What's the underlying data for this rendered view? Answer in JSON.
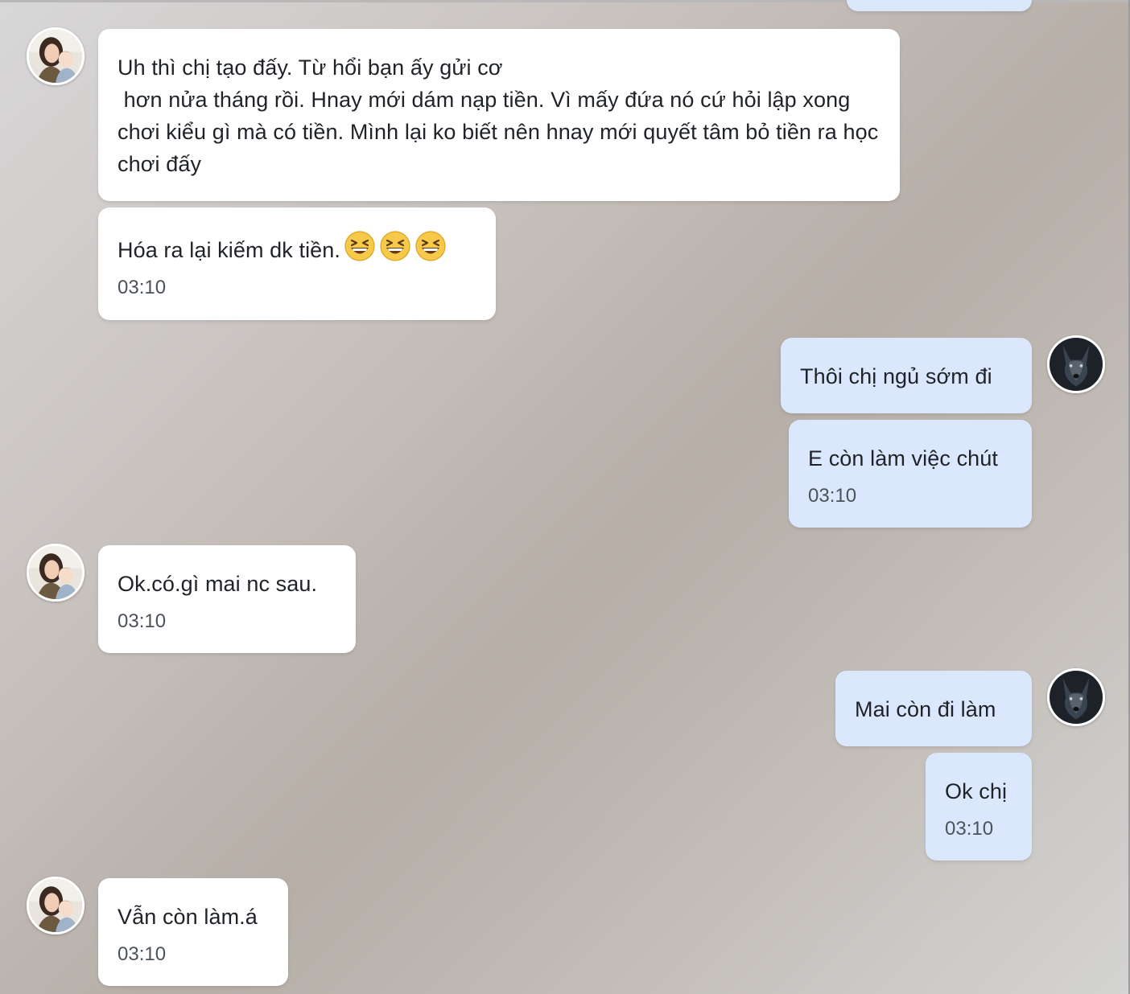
{
  "conversation": {
    "messages": [
      {
        "sender": "other",
        "text": "Uh thì chị tạo đấy. Từ hổi bạn ấy gửi cơ\n hơn nửa tháng rồi. Hnay mới dám nạp tiền. Vì mấy đứa nó cứ hỏi lập xong chơi kiểu gì mà có tiền. Mình lại ko biết nên hnay mới quyết tâm bỏ tiền ra học chơi đấy",
        "time": ""
      },
      {
        "sender": "other",
        "text": "Hóa ra lại kiếm dk tiền.",
        "emoji": [
          "grinning-squinting-face",
          "grinning-squinting-face",
          "grinning-squinting-face"
        ],
        "time": "03:10"
      },
      {
        "sender": "me",
        "text": "Thôi chị ngủ sớm đi",
        "time": ""
      },
      {
        "sender": "me",
        "text": "E còn làm việc chút",
        "time": "03:10"
      },
      {
        "sender": "other",
        "text": "Ok.có.gì mai nc sau.",
        "time": "03:10"
      },
      {
        "sender": "me",
        "text": "Mai còn đi làm",
        "time": ""
      },
      {
        "sender": "me",
        "text": "Ok chị",
        "time": "03:10"
      },
      {
        "sender": "other",
        "text": "Vẫn còn làm.á",
        "time": "03:10"
      }
    ]
  },
  "avatars": {
    "other": "woman-with-child-photo",
    "me": "black-wolf-photo"
  },
  "colors": {
    "incoming_bubble": "#ffffff",
    "outgoing_bubble": "#dbe7fd",
    "text": "#1f2328",
    "time": "#4b525a"
  }
}
